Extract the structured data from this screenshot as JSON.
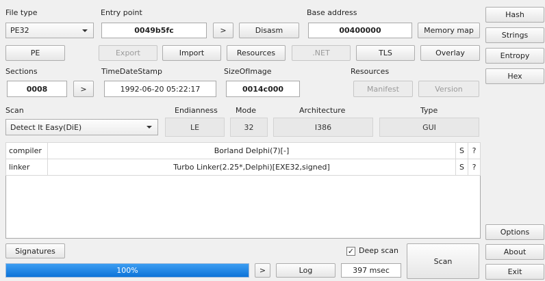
{
  "file_type": {
    "label": "File type",
    "value": "PE32"
  },
  "entry_point": {
    "label": "Entry point",
    "value": "0049b5fc",
    "go_label": ">",
    "disasm_label": "Disasm"
  },
  "base_address": {
    "label": "Base address",
    "value": "00400000",
    "memory_map_label": "Memory map"
  },
  "side_buttons": {
    "hash": "Hash",
    "strings": "Strings",
    "entropy": "Entropy",
    "hex": "Hex",
    "options": "Options",
    "about": "About",
    "exit": "Exit"
  },
  "row_buttons": {
    "pe": "PE",
    "export": "Export",
    "import": "Import",
    "resources": "Resources",
    "net": ".NET",
    "tls": "TLS",
    "overlay": "Overlay"
  },
  "sections": {
    "label": "Sections",
    "value": "0008",
    "go_label": ">"
  },
  "timedatestamp": {
    "label": "TimeDateStamp",
    "value": "1992-06-20 05:22:17"
  },
  "sizeofimage": {
    "label": "SizeOfImage",
    "value": "0014c000"
  },
  "resources_group": {
    "label": "Resources",
    "manifest": "Manifest",
    "version": "Version"
  },
  "scan": {
    "label": "Scan",
    "selected": "Detect It Easy(DiE)"
  },
  "endianness": {
    "label": "Endianness",
    "value": "LE"
  },
  "mode": {
    "label": "Mode",
    "value": "32"
  },
  "architecture": {
    "label": "Architecture",
    "value": "I386"
  },
  "type": {
    "label": "Type",
    "value": "GUI"
  },
  "results": [
    {
      "type": "compiler",
      "name": "Borland Delphi(7)[-]",
      "s": "S",
      "q": "?"
    },
    {
      "type": "linker",
      "name": "Turbo Linker(2.25*,Delphi)[EXE32,signed]",
      "s": "S",
      "q": "?"
    }
  ],
  "bottom": {
    "signatures_label": "Signatures",
    "deep_scan_label": "Deep scan",
    "deep_scan_checked": true,
    "scan_label": "Scan",
    "progress_text": "100%",
    "progress_fraction": 1.0,
    "go_label": ">",
    "log_label": "Log",
    "time_value": "397 msec"
  }
}
